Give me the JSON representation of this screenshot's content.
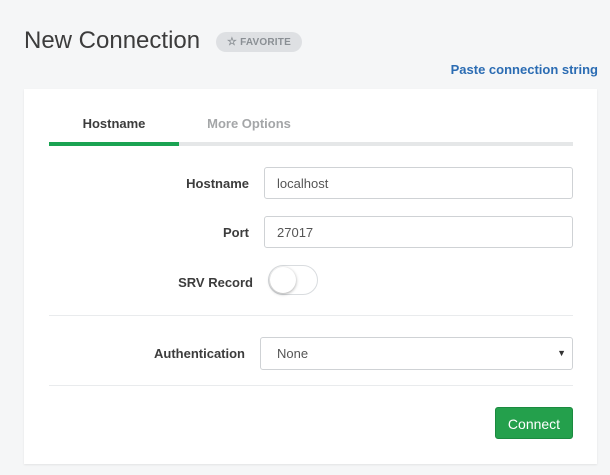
{
  "header": {
    "title": "New Connection",
    "favorite_label": "FAVORITE",
    "favorite_icon": "star-outline-icon",
    "paste_link": "Paste connection string"
  },
  "tabs": [
    {
      "label": "Hostname",
      "active": true
    },
    {
      "label": "More Options",
      "active": false
    }
  ],
  "form": {
    "hostname": {
      "label": "Hostname",
      "value": "localhost"
    },
    "port": {
      "label": "Port",
      "value": "27017"
    },
    "srv": {
      "label": "SRV Record",
      "enabled": false
    },
    "authentication": {
      "label": "Authentication",
      "value": "None"
    }
  },
  "actions": {
    "connect_label": "Connect"
  },
  "colors": {
    "accent": "#1aa352",
    "link": "#2b6cb3",
    "button": "#24a04c"
  }
}
